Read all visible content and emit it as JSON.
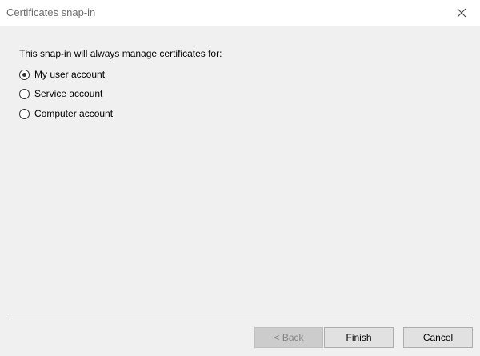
{
  "window": {
    "title": "Certificates snap-in"
  },
  "dialog": {
    "prompt": "This snap-in will always manage certificates for:",
    "options": [
      {
        "label": "My user account",
        "checked": true
      },
      {
        "label": "Service account",
        "checked": false
      },
      {
        "label": "Computer account",
        "checked": false
      }
    ]
  },
  "buttons": {
    "back": "< Back",
    "finish": "Finish",
    "cancel": "Cancel"
  },
  "colors": {
    "background": "#f0f0f0",
    "titlebar": "#ffffff",
    "button": "#e1e1e1",
    "disabled_text": "#838383"
  },
  "icons": {
    "close": "close-icon"
  }
}
